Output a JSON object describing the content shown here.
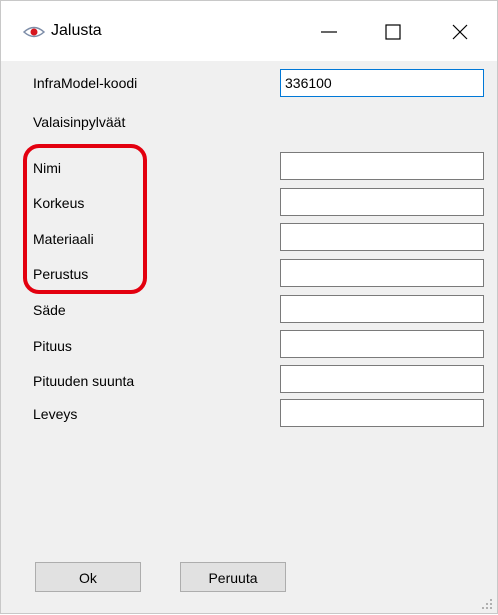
{
  "window": {
    "title": "Jalusta",
    "icon": "eye-icon"
  },
  "controls": {
    "minimize_icon": "minimize-icon",
    "maximize_icon": "maximize-icon",
    "close_icon": "close-icon"
  },
  "form": {
    "infra_label": "InfraModel-koodi",
    "infra_value": "336100",
    "section_label": "Valaisinpylväät",
    "fields": [
      {
        "label": "Nimi",
        "value": ""
      },
      {
        "label": "Korkeus",
        "value": ""
      },
      {
        "label": "Materiaali",
        "value": ""
      },
      {
        "label": "Perustus",
        "value": ""
      },
      {
        "label": "Säde",
        "value": ""
      },
      {
        "label": "Pituus",
        "value": ""
      },
      {
        "label": "Pituuden suunta",
        "value": ""
      },
      {
        "label": "Leveys",
        "value": ""
      }
    ]
  },
  "buttons": {
    "ok_label": "Ok",
    "cancel_label": "Peruuta"
  },
  "colors": {
    "highlight": "#e3000f",
    "focus_border": "#0078d7"
  }
}
